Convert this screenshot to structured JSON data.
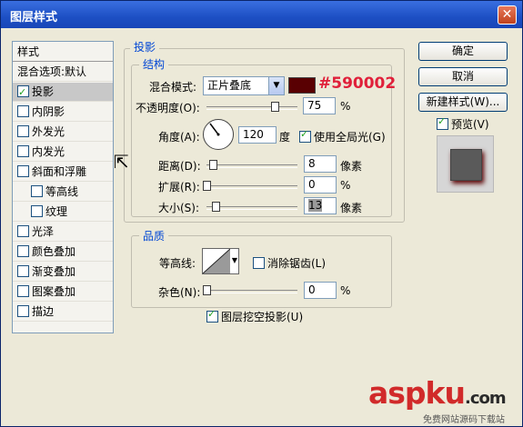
{
  "window": {
    "title": "图层样式"
  },
  "left_panel": {
    "header": "样式",
    "items": [
      {
        "label": "混合选项:默认",
        "checkbox": false,
        "selected": false,
        "sub": false
      },
      {
        "label": "投影",
        "checkbox": true,
        "checked": true,
        "selected": true,
        "sub": false
      },
      {
        "label": "内阴影",
        "checkbox": true,
        "checked": false,
        "selected": false,
        "sub": false
      },
      {
        "label": "外发光",
        "checkbox": true,
        "checked": false,
        "selected": false,
        "sub": false
      },
      {
        "label": "内发光",
        "checkbox": true,
        "checked": false,
        "selected": false,
        "sub": false
      },
      {
        "label": "斜面和浮雕",
        "checkbox": true,
        "checked": false,
        "selected": false,
        "sub": false
      },
      {
        "label": "等高线",
        "checkbox": true,
        "checked": false,
        "selected": false,
        "sub": true
      },
      {
        "label": "纹理",
        "checkbox": true,
        "checked": false,
        "selected": false,
        "sub": true
      },
      {
        "label": "光泽",
        "checkbox": true,
        "checked": false,
        "selected": false,
        "sub": false
      },
      {
        "label": "颜色叠加",
        "checkbox": true,
        "checked": false,
        "selected": false,
        "sub": false
      },
      {
        "label": "渐变叠加",
        "checkbox": true,
        "checked": false,
        "selected": false,
        "sub": false
      },
      {
        "label": "图案叠加",
        "checkbox": true,
        "checked": false,
        "selected": false,
        "sub": false
      },
      {
        "label": "描边",
        "checkbox": true,
        "checked": false,
        "selected": false,
        "sub": false
      }
    ]
  },
  "drop_shadow": {
    "group_title": "投影",
    "structure_title": "结构",
    "blend_mode_label": "混合模式:",
    "blend_mode_value": "正片叠底",
    "shadow_color": "#590002",
    "color_annotation": "#590002",
    "opacity_label": "不透明度(O):",
    "opacity_value": "75",
    "opacity_unit": "%",
    "opacity_fraction": 0.75,
    "angle_label": "角度(A):",
    "angle_value": "120",
    "angle_unit": "度",
    "global_light_label": "使用全局光(G)",
    "global_light_checked": true,
    "distance_label": "距离(D):",
    "distance_value": "8",
    "distance_unit": "像素",
    "spread_label": "扩展(R):",
    "spread_value": "0",
    "spread_unit": "%",
    "size_label": "大小(S):",
    "size_value": "13",
    "size_unit": "像素"
  },
  "quality": {
    "title": "品质",
    "contour_label": "等高线:",
    "antialias_label": "消除锯齿(L)",
    "antialias_checked": false,
    "noise_label": "杂色(N):",
    "noise_value": "0",
    "noise_unit": "%",
    "knockout_label": "图层挖空投影(U)",
    "knockout_checked": true
  },
  "buttons": {
    "ok": "确定",
    "cancel": "取消",
    "new_style": "新建样式(W)...",
    "preview_label": "预览(V)",
    "preview_checked": true
  },
  "watermark": {
    "main": "aspku",
    "suffix": ".com",
    "sub": "免费网站源码下载站"
  },
  "icons": {
    "close": "close-icon",
    "cursor": "mouse-cursor-icon"
  }
}
